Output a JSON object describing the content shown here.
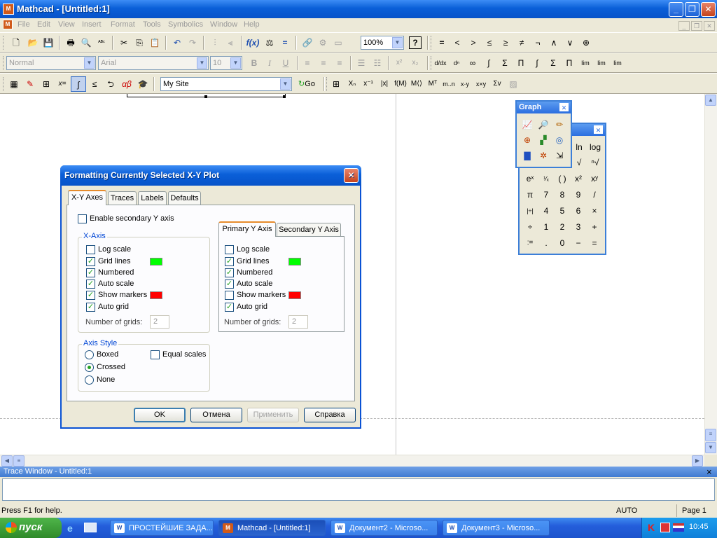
{
  "app": {
    "title": "Mathcad - [Untitled:1]",
    "icon_label": "M"
  },
  "window_buttons": {
    "minimize": "_",
    "restore": "❐",
    "close": "✕"
  },
  "menu": {
    "items": [
      "File",
      "Edit",
      "View",
      "Insert",
      "Format",
      "Tools",
      "Symbolics",
      "Window",
      "Help"
    ],
    "mdi_min": "_",
    "mdi_restore": "❐",
    "mdi_close": "✕"
  },
  "toolbar_std": {
    "zoom": "100%"
  },
  "toolbar_format": {
    "style": "Normal",
    "font": "Arial",
    "size": "10",
    "bold": "B",
    "italic": "I",
    "underline": "U"
  },
  "toolbar_math": {
    "resource": "My Site",
    "go_label": "Go"
  },
  "dialog": {
    "title": "Formatting Currently Selected X-Y Plot",
    "tabs": [
      "X-Y Axes",
      "Traces",
      "Labels",
      "Defaults"
    ],
    "enable_secondary": "Enable secondary Y axis",
    "xaxis": {
      "group_label": "X-Axis",
      "log_scale": "Log scale",
      "grid_lines": "Grid lines",
      "numbered": "Numbered",
      "auto_scale": "Auto scale",
      "show_markers": "Show markers",
      "auto_grid": "Auto grid",
      "num_grids_label": "Number of grids:",
      "num_grids": "2",
      "grid_color": "#00ff00",
      "marker_color": "#ff0000"
    },
    "yaxis": {
      "tab_primary": "Primary Y Axis",
      "tab_secondary": "Secondary Y Axis",
      "log_scale": "Log scale",
      "grid_lines": "Grid lines",
      "numbered": "Numbered",
      "auto_scale": "Auto scale",
      "show_markers": "Show markers",
      "auto_grid": "Auto grid",
      "num_grids_label": "Number of grids:",
      "num_grids": "2",
      "grid_color": "#00ff00",
      "marker_color": "#ff0000"
    },
    "axis_style": {
      "group_label": "Axis Style",
      "boxed": "Boxed",
      "crossed": "Crossed",
      "none": "None",
      "equal_scales": "Equal scales"
    },
    "buttons": {
      "ok": "OK",
      "cancel": "Отмена",
      "apply": "Применить",
      "help": "Справка"
    }
  },
  "graph_palette": {
    "title": "Graph"
  },
  "calc_palette": {
    "row1": [
      "ln",
      "log"
    ],
    "rows": [
      [
        "eˣ",
        "¹⁄ₓ",
        "( )",
        "x²",
        "xʸ"
      ],
      [
        "π",
        "7",
        "8",
        "9",
        "/"
      ],
      [
        "|÷|",
        "4",
        "5",
        "6",
        "×"
      ],
      [
        "÷",
        "1",
        "2",
        "3",
        "+"
      ],
      [
        ":=",
        ".",
        "0",
        "−",
        "="
      ]
    ]
  },
  "trace": {
    "title": "Trace Window - Untitled:1",
    "close": "×"
  },
  "status": {
    "help": "Press F1 for help.",
    "mode": "AUTO",
    "page": "Page 1"
  },
  "taskbar": {
    "start": "пуск",
    "tasks": [
      "ПРОСТЕЙШИЕ ЗАДА...",
      "Mathcad - [Untitled:1]",
      "Документ2 - Microso...",
      "Документ3 - Microso..."
    ],
    "clock": "10:45"
  }
}
